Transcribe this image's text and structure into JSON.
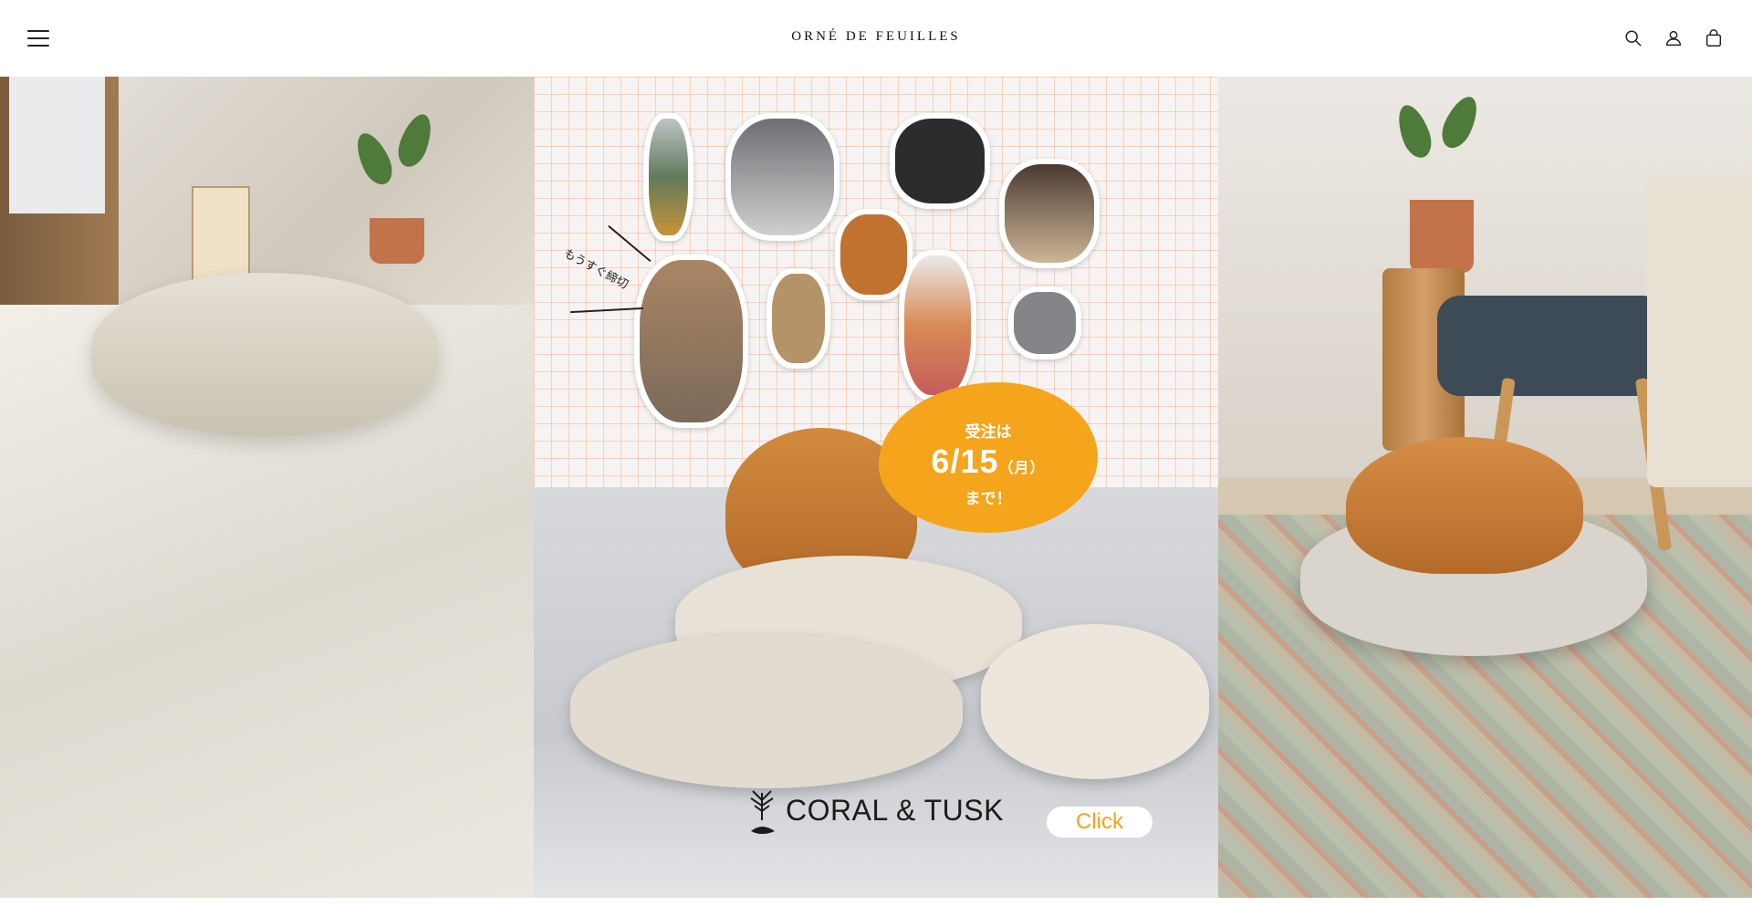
{
  "header": {
    "logo": "ORNÉ DE FEUILLES",
    "menu_icon": "menu-icon",
    "search_icon": "search-icon",
    "account_icon": "account-icon",
    "cart_icon": "cart-icon"
  },
  "banner": {
    "deadline_soon": "もうすぐ締切",
    "order_label": "受注は",
    "order_date": "6/15",
    "order_day": "（月）",
    "order_until": "まで！",
    "brand_name": "CORAL & TUSK",
    "cta_label": "Click"
  },
  "colors": {
    "badge": "#f5a51c",
    "cta_text": "#f0a21e"
  }
}
